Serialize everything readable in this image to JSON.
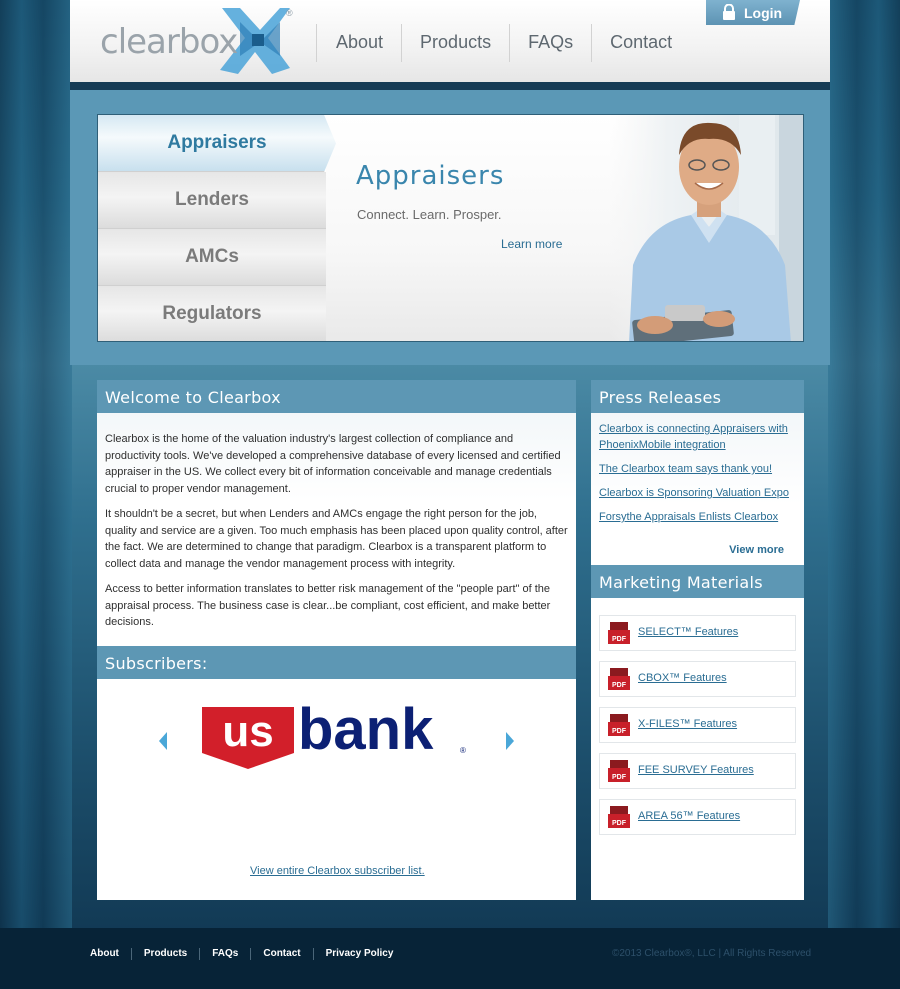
{
  "header": {
    "logo_text": "clearbox",
    "logo_reg": "®",
    "nav": [
      "About",
      "Products",
      "FAQs",
      "Contact"
    ],
    "login_label": "Login"
  },
  "hero": {
    "tabs": [
      "Appraisers",
      "Lenders",
      "AMCs",
      "Regulators"
    ],
    "active_tab": "Appraisers",
    "title": "Appraisers",
    "subtitle": "Connect. Learn. Prosper.",
    "link": "Learn more"
  },
  "welcome": {
    "title": "Welcome to Clearbox",
    "paragraphs": [
      "Clearbox is the home of the valuation industry's largest collection of compliance and productivity tools. We've developed a comprehensive database of every licensed and certified appraiser in the US. We collect every bit of information conceivable and manage credentials crucial to proper vendor management.",
      "It shouldn't be a secret, but when Lenders and AMCs engage the right person for the job, quality and service are a given. Too much emphasis has been placed upon quality control, after the fact. We are determined to change that paradigm. Clearbox is a transparent platform to collect data and manage the vendor management process with integrity.",
      "Access to better information translates to better risk management of the \"people part\" of the appraisal process. The business case is clear...be compliant, cost efficient, and make better decisions."
    ]
  },
  "subscribers": {
    "title": "Subscribers:",
    "logo_us": "us",
    "logo_bank": "bank",
    "logo_reg": "®",
    "link": "View entire Clearbox subscriber list."
  },
  "press": {
    "title": "Press Releases",
    "items": [
      "Clearbox is connecting Appraisers with PhoenixMobile integration",
      "The Clearbox team says thank you!",
      "Clearbox is Sponsoring Valuation Expo",
      "Forsythe Appraisals Enlists Clearbox"
    ],
    "view_more": "View more"
  },
  "marketing": {
    "title": "Marketing Materials",
    "pdf_badge": "PDF",
    "items": [
      "SELECT™ Features",
      "CBOX™ Features",
      "X-FILES™ Features",
      "FEE SURVEY Features",
      "AREA 56™ Features"
    ]
  },
  "footer": {
    "links": [
      "About",
      "Products",
      "FAQs",
      "Contact",
      "Privacy Policy"
    ],
    "copyright": "©2013 Clearbox®, LLC | All Rights Reserved"
  },
  "colors": {
    "accent": "#5d97b4",
    "link": "#2a6d93",
    "hero_title": "#3a86ad",
    "pdf_red": "#c8202a",
    "usbank_red": "#d21f2a",
    "usbank_blue": "#0c2074"
  }
}
